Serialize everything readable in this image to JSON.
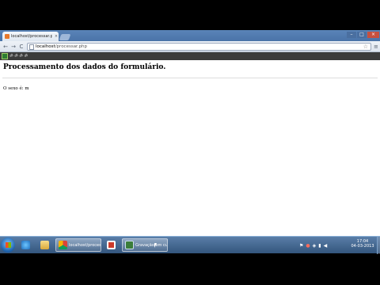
{
  "browser": {
    "tab_title": "localhost/processar.php",
    "tab_close": "×",
    "url_host": "localhost",
    "url_path": "/processar.php",
    "window_controls": {
      "minimize": "–",
      "maximize": "□",
      "close": "×"
    },
    "nav": {
      "back": "←",
      "forward": "→",
      "reload": "C"
    },
    "extension_label": "ॐ ॐ ॐ ॐ"
  },
  "page": {
    "heading": "Processamento dos dados do formulário.",
    "result_text": "O sexo é: m"
  },
  "taskbar": {
    "items": [
      {
        "name": "internet-explorer",
        "label": ""
      },
      {
        "name": "file-explorer",
        "label": ""
      },
      {
        "name": "chrome",
        "label": "localhost/process..."
      },
      {
        "name": "recorder",
        "label": ""
      },
      {
        "name": "camtasia",
        "label": "Gravação em curso..."
      }
    ],
    "clock_time": "17:04",
    "clock_date": "04-03-2013"
  },
  "colors": {
    "taskbar": "#3d6189",
    "tabstrip": "#4f79ad",
    "close": "#c7503f"
  }
}
